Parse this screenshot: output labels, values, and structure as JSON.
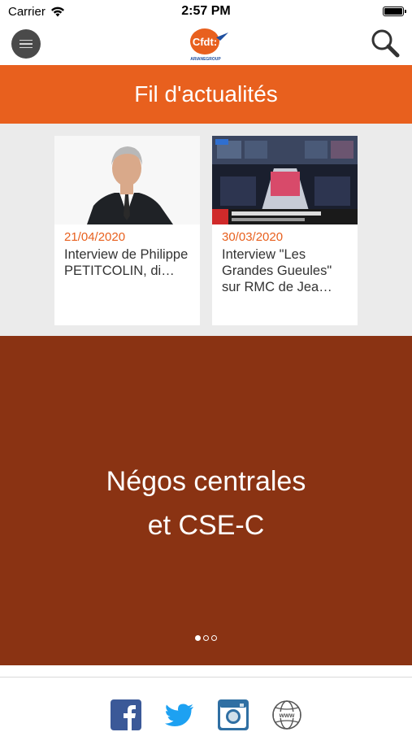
{
  "status_bar": {
    "carrier": "Carrier",
    "time": "2:57 PM"
  },
  "header": {
    "logo_text": "Cfdt:",
    "logo_subtext": "ARIANEGROUP"
  },
  "section": {
    "title": "Fil d'actualités"
  },
  "news": [
    {
      "date": "21/04/2020",
      "title": "Interview de Philippe PETITCOLIN, di…"
    },
    {
      "date": "30/03/2020",
      "title": "Interview \"Les Grandes Gueules\" sur RMC de Jea…"
    }
  ],
  "banner": {
    "line1": "Négos centrales",
    "line2": "et CSE-C",
    "page_count": 3,
    "active_page": 1
  },
  "footer": {
    "icons": [
      "facebook-icon",
      "twitter-icon",
      "instagram-icon",
      "website-icon"
    ]
  },
  "colors": {
    "accent": "#e8601e",
    "banner": "#8a3313",
    "facebook": "#3b5998",
    "twitter": "#1da1f2",
    "instagram": "#2f6fa3"
  }
}
